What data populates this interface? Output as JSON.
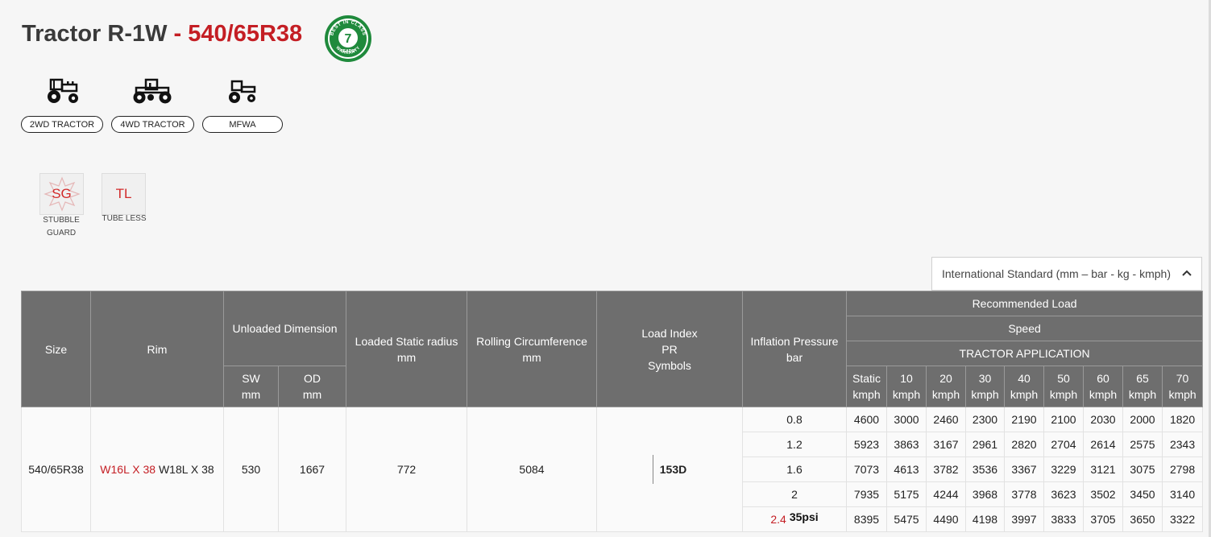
{
  "title": {
    "model": "Tractor R-1W",
    "separator": " - ",
    "size": "540/65R38"
  },
  "warranty_badge": {
    "top_text": "BEST IN CLASS",
    "number": "7",
    "sub_text": "YEARS*",
    "bottom_text": "WARRANTY"
  },
  "applications": [
    {
      "label": "2WD TRACTOR",
      "icon": "tractor-2wd-icon"
    },
    {
      "label": "4WD TRACTOR",
      "icon": "tractor-4wd-icon"
    },
    {
      "label": "MFWA",
      "icon": "tractor-mfwa-icon"
    }
  ],
  "features": [
    {
      "code": "SG",
      "label_line1": "STUBBLE",
      "label_line2": "GUARD"
    },
    {
      "code": "TL",
      "label_line1": "TUBE LESS",
      "label_line2": ""
    }
  ],
  "unit_selector": {
    "value": "International Standard (mm – bar - kg - kmph)",
    "icon": "chevron-up-icon"
  },
  "table": {
    "headers": {
      "size": "Size",
      "rim": "Rim",
      "unloaded_dimension": "Unloaded Dimension",
      "sw_line1": "SW",
      "sw_line2": "mm",
      "od_line1": "OD",
      "od_line2": "mm",
      "loaded_radius_line1": "Loaded Static radius",
      "loaded_radius_line2": "mm",
      "rolling_line1": "Rolling Circumference",
      "rolling_line2": "mm",
      "load_index_line1": "Load Index",
      "load_index_line2": "PR",
      "load_index_line3": "Symbols",
      "inflation_line1": "Inflation Pressure",
      "inflation_line2": "bar",
      "recommended_load": "Recommended Load",
      "speed": "Speed",
      "tractor_application": "TRACTOR APPLICATION",
      "speeds": [
        {
          "v": "Static",
          "u": "kmph"
        },
        {
          "v": "10",
          "u": "kmph"
        },
        {
          "v": "20",
          "u": "kmph"
        },
        {
          "v": "30",
          "u": "kmph"
        },
        {
          "v": "40",
          "u": "kmph"
        },
        {
          "v": "50",
          "u": "kmph"
        },
        {
          "v": "60",
          "u": "kmph"
        },
        {
          "v": "65",
          "u": "kmph"
        },
        {
          "v": "70",
          "u": "kmph"
        }
      ]
    },
    "row": {
      "size": "540/65R38",
      "rim_primary": "W16L X 38",
      "rim_alt": "W18L X 38",
      "sw": "530",
      "od": "1667",
      "loaded_radius": "772",
      "rolling_circumference": "5084",
      "load_index": "153D"
    },
    "pressures": [
      {
        "bar": "0.8",
        "psi": "",
        "loads": [
          "4600",
          "3000",
          "2460",
          "2300",
          "2190",
          "2100",
          "2030",
          "2000",
          "1820"
        ]
      },
      {
        "bar": "1.2",
        "psi": "",
        "loads": [
          "5923",
          "3863",
          "3167",
          "2961",
          "2820",
          "2704",
          "2614",
          "2575",
          "2343"
        ]
      },
      {
        "bar": "1.6",
        "psi": "",
        "loads": [
          "7073",
          "4613",
          "3782",
          "3536",
          "3367",
          "3229",
          "3121",
          "3075",
          "2798"
        ]
      },
      {
        "bar": "2",
        "psi": "",
        "loads": [
          "7935",
          "5175",
          "4244",
          "3968",
          "3778",
          "3623",
          "3502",
          "3450",
          "3140"
        ]
      },
      {
        "bar": "2.4",
        "psi": "35psi",
        "loads": [
          "8395",
          "5475",
          "4490",
          "4198",
          "3997",
          "3833",
          "3705",
          "3650",
          "3322"
        ]
      }
    ]
  }
}
